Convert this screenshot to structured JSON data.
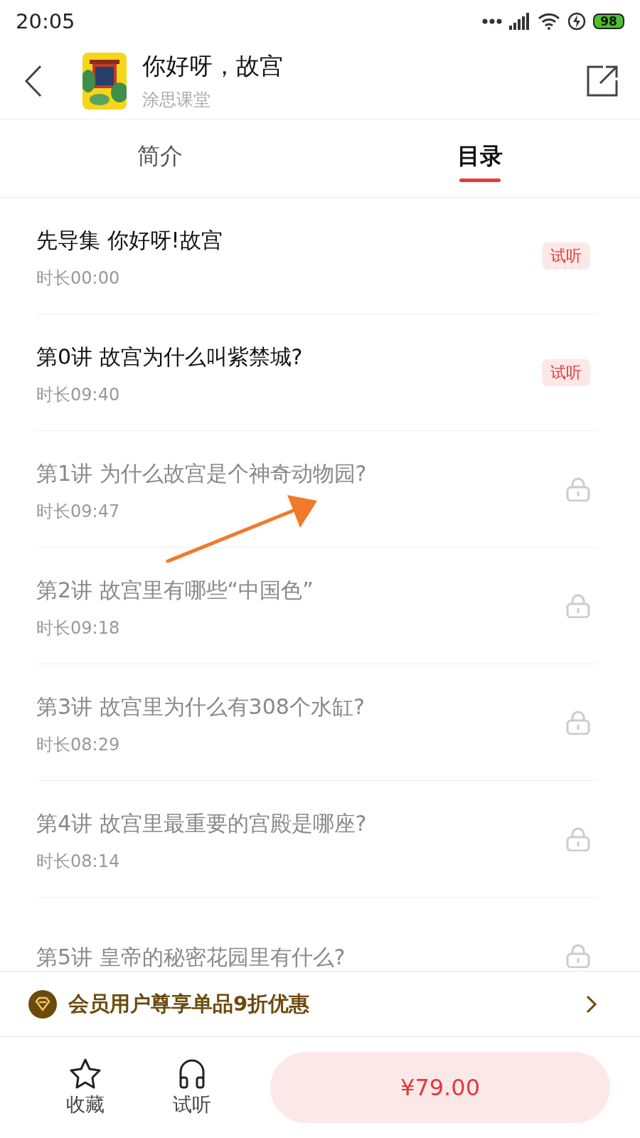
{
  "status_bar": {
    "time": "20:05",
    "battery": "98"
  },
  "header": {
    "title": "你好呀，故宫",
    "subtitle": "涂思课堂"
  },
  "tabs": [
    {
      "label": "简介",
      "selected": false
    },
    {
      "label": "目录",
      "selected": true
    }
  ],
  "lessons": [
    {
      "title": "先导集 你好呀!故宫",
      "duration": "时长00:00",
      "locked": false,
      "badge": "试听"
    },
    {
      "title": "第0讲 故宫为什么叫紫禁城?",
      "duration": "时长09:40",
      "locked": false,
      "badge": "试听"
    },
    {
      "title": "第1讲 为什么故宫是个神奇动物园?",
      "duration": "时长09:47",
      "locked": true
    },
    {
      "title": "第2讲 故宫里有哪些“中国色”",
      "duration": "时长09:18",
      "locked": true
    },
    {
      "title": "第3讲 故宫里为什么有308个水缸?",
      "duration": "时长08:29",
      "locked": true
    },
    {
      "title": "第4讲 故宫里最重要的宫殿是哪座?",
      "duration": "时长08:14",
      "locked": true
    },
    {
      "title": "第5讲 皇帝的秘密花园里有什么?",
      "locked": true
    }
  ],
  "member_bar": {
    "text": "会员用户尊享单品9折优惠"
  },
  "bottom_bar": {
    "actions": [
      {
        "kind": "favorite",
        "label": "收藏"
      },
      {
        "kind": "listen",
        "label": "试听"
      }
    ],
    "price": "¥79.00"
  }
}
